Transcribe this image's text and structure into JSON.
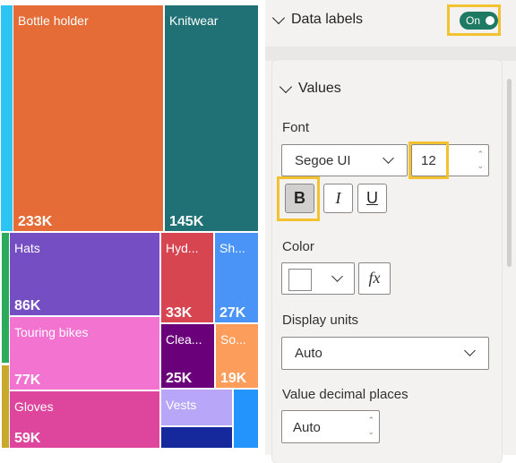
{
  "chart_data": {
    "type": "treemap",
    "title": "",
    "data_labels": true,
    "tiles": [
      {
        "name": "Bottle holder",
        "label": "Bottle holder",
        "value": 233000,
        "value_label": "233K",
        "color": "#e66c37"
      },
      {
        "name": "Knitwear",
        "label": "Knitwear",
        "value": 145000,
        "value_label": "145K",
        "color": "#1f7175"
      },
      {
        "name": "Hats",
        "label": "Hats",
        "value": 86000,
        "value_label": "86K",
        "color": "#744ec2"
      },
      {
        "name": "Touring bikes",
        "label": "Touring bikes",
        "value": 77000,
        "value_label": "77K",
        "color": "#f274d0"
      },
      {
        "name": "Gloves",
        "label": "Gloves",
        "value": 59000,
        "value_label": "59K",
        "color": "#de469d"
      },
      {
        "name": "Hyd...",
        "label": "Hyd...",
        "value": 33000,
        "value_label": "33K",
        "color": "#d64550"
      },
      {
        "name": "Sh...",
        "label": "Sh...",
        "value": 27000,
        "value_label": "27K",
        "color": "#4a94f8"
      },
      {
        "name": "Clea...",
        "label": "Clea...",
        "value": 25000,
        "value_label": "25K",
        "color": "#6b007b"
      },
      {
        "name": "So...",
        "label": "So...",
        "value": 19000,
        "value_label": "19K",
        "color": "#fd9d5c"
      },
      {
        "name": "Vests",
        "label": "Vests",
        "value": null,
        "value_label": "",
        "color": "#b8a6f8"
      },
      {
        "name": "",
        "label": "",
        "value": null,
        "value_label": "",
        "color": "#15289c"
      },
      {
        "name": "",
        "label": "",
        "value": null,
        "value_label": "",
        "color": "#2394fb"
      }
    ],
    "group_strips": [
      {
        "color": "#2bc4f3"
      },
      {
        "color": "#2aac5c"
      },
      {
        "color": "#c8a92c"
      }
    ]
  },
  "panel": {
    "data_labels": {
      "title": "Data labels",
      "toggle_label": "On",
      "toggle_state": true
    },
    "values": {
      "title": "Values",
      "font_label": "Font",
      "font_family": "Segoe UI",
      "font_size": "12",
      "bold": {
        "label": "B",
        "active": true
      },
      "italic": {
        "label": "I",
        "active": false
      },
      "underline": {
        "label": "U",
        "active": false
      },
      "color_label": "Color",
      "color_value": "#ffffff",
      "fx_label": "fx",
      "display_units_label": "Display units",
      "display_units_value": "Auto",
      "decimal_places_label": "Value decimal places",
      "decimal_places_value": "Auto"
    }
  }
}
